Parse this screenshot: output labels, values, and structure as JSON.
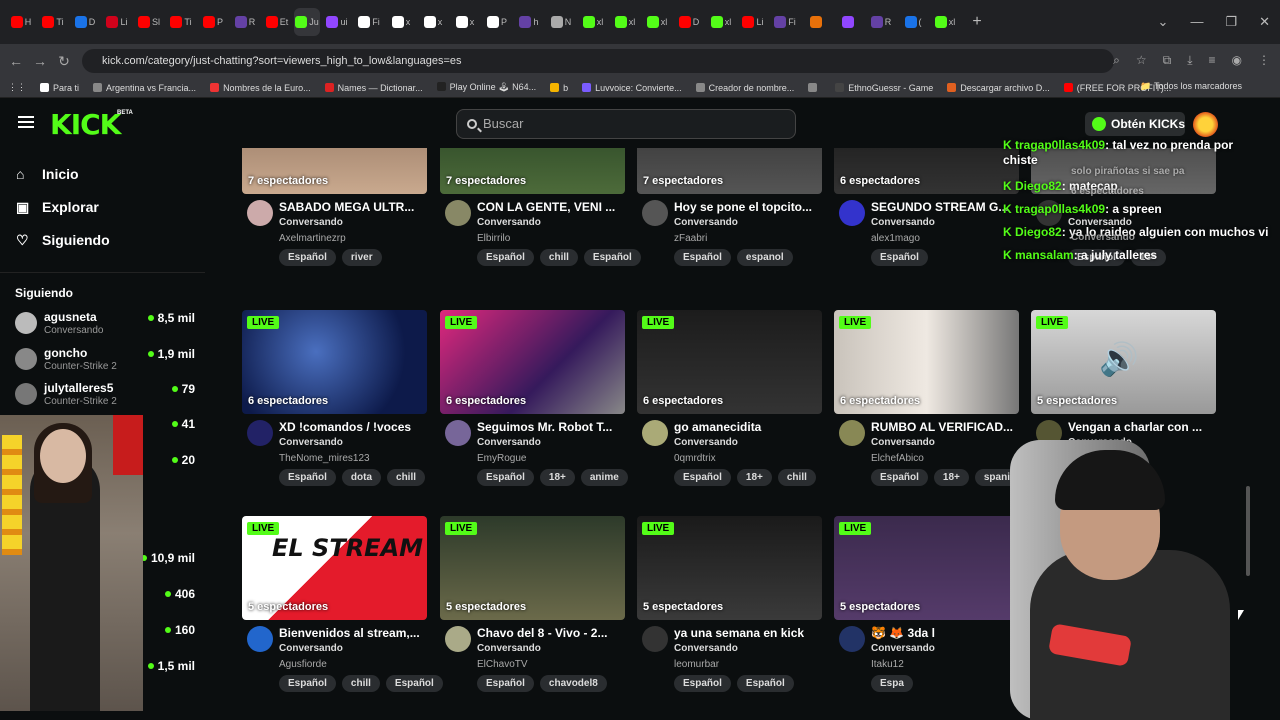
{
  "browser": {
    "tabs": [
      {
        "label": "H",
        "color": "#ff0000"
      },
      {
        "label": "Ti",
        "color": "#ff0000"
      },
      {
        "label": "D",
        "color": "#1a73e8"
      },
      {
        "label": "Li",
        "color": "#d0021b"
      },
      {
        "label": "Sl",
        "color": "#ff0000"
      },
      {
        "label": "Ti",
        "color": "#ff0000"
      },
      {
        "label": "P",
        "color": "#ff0000"
      },
      {
        "label": "R",
        "color": "#6441a5"
      },
      {
        "label": "Et",
        "color": "#ff0000"
      },
      {
        "label": "Ju",
        "color": "#53fc18"
      },
      {
        "label": "ui",
        "color": "#9147ff"
      },
      {
        "label": "Fi",
        "color": "#ffffff"
      },
      {
        "label": "x",
        "color": "#ffffff"
      },
      {
        "label": "x",
        "color": "#ffffff"
      },
      {
        "label": "x",
        "color": "#ffffff"
      },
      {
        "label": "P",
        "color": "#ffffff"
      },
      {
        "label": "h",
        "color": "#6441a5"
      },
      {
        "label": "N",
        "color": "#aaaaaa"
      },
      {
        "label": "xl",
        "color": "#53fc18"
      },
      {
        "label": "xl",
        "color": "#53fc18"
      },
      {
        "label": "xl",
        "color": "#53fc18"
      },
      {
        "label": "D",
        "color": "#ff0000"
      },
      {
        "label": "xl",
        "color": "#53fc18"
      },
      {
        "label": "Li",
        "color": "#ff0000"
      },
      {
        "label": "Fi",
        "color": "#6441a5"
      },
      {
        "label": "",
        "color": "#e8710a"
      },
      {
        "label": "",
        "color": "#9147ff"
      },
      {
        "label": "R",
        "color": "#6441a5"
      },
      {
        "label": "(",
        "color": "#1a73e8"
      },
      {
        "label": "xl",
        "color": "#53fc18"
      }
    ],
    "new_tab": "+",
    "url": "kick.com/category/just-chatting?sort=viewers_high_to_low&languages=es",
    "bookmarks": [
      {
        "label": "Para ti",
        "color": "#ffffff"
      },
      {
        "label": "Argentina vs Francia...",
        "color": "#888888"
      },
      {
        "label": "Nombres de la Euro...",
        "color": "#e33"
      },
      {
        "label": "Names — Dictionar...",
        "color": "#d22"
      },
      {
        "label": "Play Online 🕹 N64...",
        "color": "#222"
      },
      {
        "label": "b",
        "color": "#f5b400"
      },
      {
        "label": "Luvvoice: Convierte...",
        "color": "#7a5cff"
      },
      {
        "label": "Creador de nombre...",
        "color": "#888"
      },
      {
        "label": "",
        "color": "#888"
      },
      {
        "label": "EthnoGuessr - Game",
        "color": "#444"
      },
      {
        "label": "Descargar archivo D...",
        "color": "#e06020"
      },
      {
        "label": "(FREE FOR PROFIT)...",
        "color": "#ff0000"
      }
    ],
    "bookmarks_all": "Todos los marcadores"
  },
  "header": {
    "logo": "KICK",
    "beta": "BETA",
    "search_placeholder": "Buscar",
    "kicks_button": "Obtén KICKs"
  },
  "sidebar": {
    "nav": [
      {
        "label": "Inicio",
        "icon": "home-icon"
      },
      {
        "label": "Explorar",
        "icon": "compass-icon"
      },
      {
        "label": "Siguiendo",
        "icon": "heart-icon"
      }
    ],
    "following_title": "Siguiendo",
    "following": [
      {
        "name": "agusneta",
        "category": "Conversando",
        "viewers": "8,5 mil"
      },
      {
        "name": "goncho",
        "category": "Counter-Strike 2",
        "viewers": "1,9 mil"
      },
      {
        "name": "julytalleres5",
        "category": "Counter-Strike 2",
        "viewers": "79"
      }
    ],
    "extra_counts": [
      "41",
      "20",
      "10,9 mil",
      "406",
      "160",
      "1,5 mil"
    ]
  },
  "cards": [
    {
      "viewers": "7 espectadores",
      "title": "SABADO MEGA ULTR...",
      "category": "Conversando",
      "user": "Axelmartinezrp",
      "tags": [
        "Español",
        "river"
      ],
      "live": false,
      "avatar": "#caa"
    },
    {
      "viewers": "7 espectadores",
      "title": "CON LA GENTE, VENI ...",
      "category": "Conversando",
      "user": "Elbirrilo",
      "tags": [
        "Español",
        "chill",
        "Español"
      ],
      "live": false,
      "avatar": "#886"
    },
    {
      "viewers": "7 espectadores",
      "title": "Hoy se pone el topcito...",
      "category": "Conversando",
      "user": "zFaabri",
      "tags": [
        "Español",
        "espanol"
      ],
      "live": false,
      "avatar": "#555"
    },
    {
      "viewers": "6 espectadores",
      "title": "SEGUNDO STREAM G...",
      "category": "Conversando",
      "user": "alex1mago",
      "tags": [
        "Español"
      ],
      "live": false,
      "avatar": "#33c"
    },
    {
      "viewers": "",
      "title": "",
      "category": "Conversando",
      "user": "",
      "tags": [
        "Español",
        "18+"
      ],
      "live": false,
      "avatar": "#333"
    },
    {
      "viewers": "6 espectadores",
      "title": "XD !comandos / !voces",
      "category": "Conversando",
      "user": "TheNome_mires123",
      "tags": [
        "Español",
        "dota",
        "chill"
      ],
      "live": true,
      "avatar": "#226"
    },
    {
      "viewers": "6 espectadores",
      "title": "Seguimos Mr. Robot T...",
      "category": "Conversando",
      "user": "EmyRogue",
      "tags": [
        "Español",
        "18+",
        "anime"
      ],
      "live": true,
      "avatar": "#769"
    },
    {
      "viewers": "6 espectadores",
      "title": "go amanecidita",
      "category": "Conversando",
      "user": "0qmrdtrix",
      "tags": [
        "Español",
        "18+",
        "chill"
      ],
      "live": true,
      "avatar": "#aa7"
    },
    {
      "viewers": "6 espectadores",
      "title": "RUMBO AL VERIFICAD...",
      "category": "Conversando",
      "user": "ElchefAbico",
      "tags": [
        "Español",
        "18+",
        "spani"
      ],
      "live": true,
      "avatar": "#885"
    },
    {
      "viewers": "5 espectadores",
      "title": "Vengan a charlar con ...",
      "category": "Conversando",
      "user": "",
      "tags": [],
      "live": true,
      "avatar": "#553"
    },
    {
      "viewers": "5 espectadores",
      "title": "Bienvenidos al stream,...",
      "category": "Conversando",
      "user": "Agusfiorde",
      "tags": [
        "Español",
        "chill",
        "Español"
      ],
      "live": true,
      "avatar": "#26c"
    },
    {
      "viewers": "5 espectadores",
      "title": "Chavo del 8 - Vivo - 2...",
      "category": "Conversando",
      "user": "ElChavoTV",
      "tags": [
        "Español",
        "chavodel8"
      ],
      "live": true,
      "avatar": "#aa8"
    },
    {
      "viewers": "5 espectadores",
      "title": "ya una semana en kick",
      "category": "Conversando",
      "user": "leomurbar",
      "tags": [
        "Español",
        "Español"
      ],
      "live": true,
      "avatar": "#333"
    },
    {
      "viewers": "5 espectadores",
      "title": "🐯 🦊 3da l",
      "category": "Conversando",
      "user": "Itaku12",
      "tags": [
        "Espa"
      ],
      "live": true,
      "avatar": "#236"
    }
  ],
  "chat": [
    {
      "user": "tragap0llas4k09",
      "text": ": tal vez no prenda por"
    },
    {
      "user": "",
      "text": "chiste"
    },
    {
      "user": "Diego82",
      "text": ": matecap"
    },
    {
      "user": "tragap0llas4k09",
      "text": ": a spreen"
    },
    {
      "user": "Diego82",
      "text": ": ya lo raideo alguien con muchos vi"
    },
    {
      "user": "mansalam",
      "text": ": a july talleres"
    }
  ],
  "chat_overlay_bits": [
    "solo pirañotas si sae pa",
    "Conversando",
    "6 espectadores"
  ]
}
